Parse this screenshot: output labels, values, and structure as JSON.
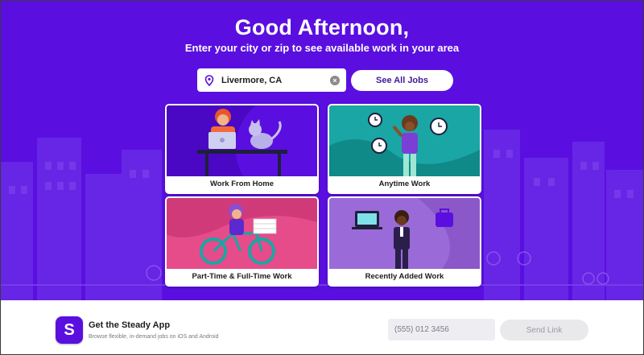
{
  "hero": {
    "greeting": "Good Afternoon,",
    "subtitle": "Enter your city or zip to see available work in your area",
    "background_color": "#5a0fe0"
  },
  "search": {
    "value": "Livermore, CA",
    "icon": "map-pin-icon",
    "clear_icon": "clear-icon"
  },
  "see_all_button": {
    "label": "See All Jobs"
  },
  "categories": [
    {
      "label": "Work From Home",
      "art_color": "#5a0fe0"
    },
    {
      "label": "Anytime Work",
      "art_color": "#1aa6a4"
    },
    {
      "label": "Part-Time & Full-Time Work",
      "art_color": "#e64b8a"
    },
    {
      "label": "Recently Added Work",
      "art_color": "#9a6bd8"
    }
  ],
  "footer": {
    "app_title": "Get the Steady App",
    "app_subtitle": "Browse flexible, in-demand jobs on iOS and Android",
    "app_icon_letter": "S",
    "phone_placeholder": "(555) 012 3456",
    "send_label": "Send Link"
  }
}
